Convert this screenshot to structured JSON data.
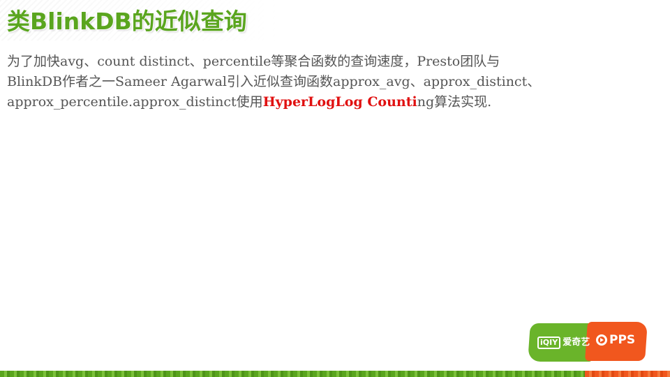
{
  "slide": {
    "title": "类BlinkDB的近似查询",
    "body": {
      "line1": "为了加快avg、count distinct、percentile等聚合函数的查询速度，Presto团队与",
      "line2": "BlinkDB作者之一Sameer Agarwal引入近似查询函数approx_avg、approx_distinct、",
      "line3_prefix": "approx_percentile.approx_distinct使用",
      "line3_highlight": "HyperLogLog Counti",
      "line3_suffix": "ng算法实现."
    },
    "logo": {
      "qiyi_box": "iQIY",
      "qiyi_label": "爱奇艺",
      "pps_label": "PPS"
    }
  },
  "colors": {
    "title": "#5aa51e",
    "body_text": "#555555",
    "highlight": "#e01010",
    "logo_green": "#6ab42a",
    "logo_orange": "#f1571e"
  }
}
